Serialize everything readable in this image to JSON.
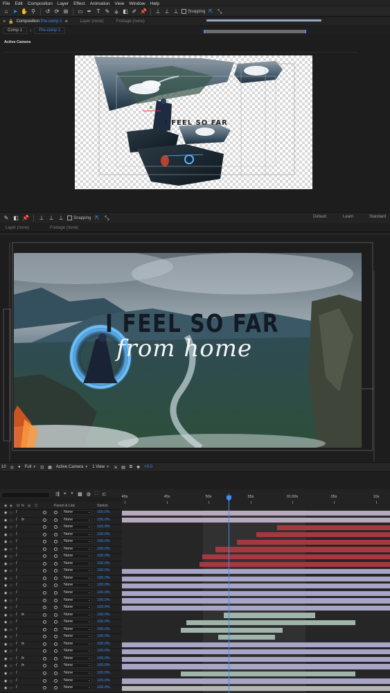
{
  "menu": [
    "File",
    "Edit",
    "Composition",
    "Layer",
    "Effect",
    "Animation",
    "View",
    "Window",
    "Help"
  ],
  "toolbar": {
    "snapping_label": "Snapping"
  },
  "comp_panel": {
    "title_prefix": "Composition",
    "title_comp": "Pre-comp 1",
    "layer_label": "Layer (none)",
    "footage_label": "Footage (none)",
    "tabs": [
      "Comp 1",
      "Pre-comp 1"
    ],
    "active_camera": "Active Camera"
  },
  "top_canvas_text": "I FEEL SO FAR",
  "toolbar2": {
    "snapping_label": "Snapping",
    "workspaces": [
      "Default",
      "Learn",
      "Standard"
    ]
  },
  "lower_panel": {
    "layer_label": "Layer (none)",
    "footage_label": "Footage (none)"
  },
  "main_canvas": {
    "line1": "I FEEL SO FAR",
    "line2": "from home"
  },
  "viewer_footer": {
    "zoom": "10",
    "resolution": "Full",
    "camera": "Active Camera",
    "views": "1 View",
    "exposure": "+0.0"
  },
  "timeline": {
    "ruler_labels": [
      "40s",
      "45s",
      "50s",
      "55s",
      "01:00s",
      "05s",
      "10s"
    ],
    "headers": {
      "parent": "Parent & Link",
      "stretch": "Stretch"
    },
    "rows": [
      {
        "fx": false,
        "parent": "None",
        "stretch": "100.0%",
        "bar_color": "#b7a9be",
        "start": 0.0,
        "end": 1.0
      },
      {
        "fx": true,
        "parent": "None",
        "stretch": "100.0%",
        "bar_color": "#b7a9be",
        "start": 0.0,
        "end": 1.0
      },
      {
        "fx": false,
        "parent": "None",
        "stretch": "100.0%",
        "bar_color": "#a43a3f",
        "start": 0.58,
        "end": 1.0
      },
      {
        "fx": false,
        "parent": "None",
        "stretch": "100.0%",
        "bar_color": "#a43a3f",
        "start": 0.5,
        "end": 1.0
      },
      {
        "fx": false,
        "parent": "None",
        "stretch": "100.0%",
        "bar_color": "#a43a3f",
        "start": 0.43,
        "end": 1.0
      },
      {
        "fx": false,
        "parent": "None",
        "stretch": "100.0%",
        "bar_color": "#a43a3f",
        "start": 0.35,
        "end": 1.0
      },
      {
        "fx": false,
        "parent": "None",
        "stretch": "100.0%",
        "bar_color": "#a43a3f",
        "start": 0.3,
        "end": 1.0
      },
      {
        "fx": false,
        "parent": "None",
        "stretch": "100.0%",
        "bar_color": "#a43a3f",
        "start": 0.29,
        "end": 1.0
      },
      {
        "fx": false,
        "parent": "None",
        "stretch": "100.0%",
        "bar_color": "#a8a5c6",
        "start": 0.0,
        "end": 1.0
      },
      {
        "fx": false,
        "parent": "None",
        "stretch": "100.0%",
        "bar_color": "#a8a5c6",
        "start": 0.0,
        "end": 1.0
      },
      {
        "fx": false,
        "parent": "None",
        "stretch": "100.0%",
        "bar_color": "#a8a5c6",
        "start": 0.0,
        "end": 1.0
      },
      {
        "fx": false,
        "parent": "None",
        "stretch": "100.0%",
        "bar_color": "#a8a5c6",
        "start": 0.0,
        "end": 1.0
      },
      {
        "fx": false,
        "parent": "None",
        "stretch": "100.0%",
        "bar_color": "#a8a5c6",
        "start": 0.0,
        "end": 1.0
      },
      {
        "fx": false,
        "parent": "None",
        "stretch": "100.0%",
        "bar_color": "#a8a5c6",
        "start": 0.0,
        "end": 1.0
      },
      {
        "fx": true,
        "parent": "None",
        "stretch": "100.0%",
        "bar_color": "#9fb5ab",
        "start": 0.38,
        "end": 0.72
      },
      {
        "fx": false,
        "parent": "None",
        "stretch": "100.0%",
        "bar_color": "#9fb5ab",
        "start": 0.24,
        "end": 0.87
      },
      {
        "fx": false,
        "parent": "None",
        "stretch": "100.0%",
        "bar_color": "#9fb5ab",
        "start": 0.22,
        "end": 0.6
      },
      {
        "fx": false,
        "parent": "None",
        "stretch": "100.0%",
        "bar_color": "#9fb5ab",
        "start": 0.36,
        "end": 0.57
      },
      {
        "fx": true,
        "parent": "None",
        "stretch": "100.0%",
        "bar_color": "#a8a5c6",
        "start": 0.0,
        "end": 1.0
      },
      {
        "fx": false,
        "parent": "None",
        "stretch": "100.0%",
        "bar_color": "#a8a5c6",
        "start": 0.0,
        "end": 1.0
      },
      {
        "fx": true,
        "parent": "None",
        "stretch": "100.0%",
        "bar_color": "#a8a5c6",
        "start": 0.0,
        "end": 1.0
      },
      {
        "fx": true,
        "parent": "None",
        "stretch": "100.0%",
        "bar_color": "#a8a5c6",
        "start": 0.0,
        "end": 1.0
      },
      {
        "fx": false,
        "parent": "None",
        "stretch": "100.0%",
        "bar_color": "#9fb5ab",
        "start": 0.22,
        "end": 0.87
      },
      {
        "fx": false,
        "parent": "None",
        "stretch": "100.0%",
        "bar_color": "#a8a5c6",
        "start": 0.0,
        "end": 1.0
      },
      {
        "fx": false,
        "parent": "None",
        "stretch": "100.0%",
        "bar_color": "#b4b8b5",
        "start": 0.0,
        "end": 1.0
      }
    ]
  }
}
